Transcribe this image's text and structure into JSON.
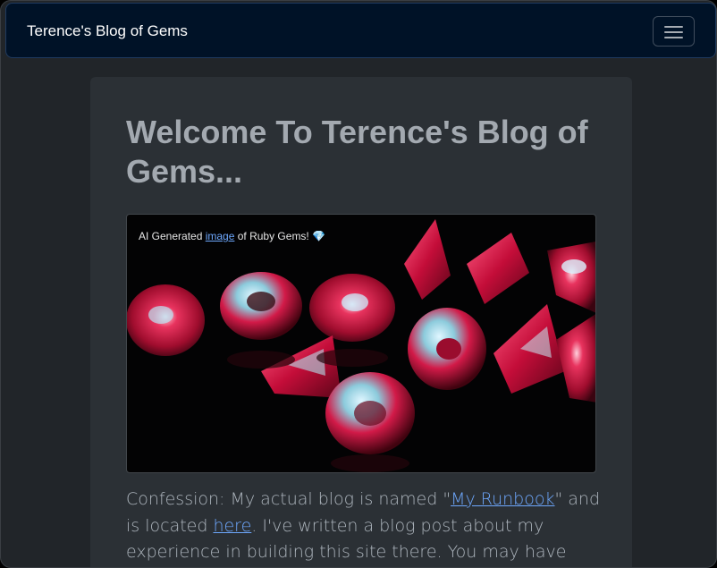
{
  "navbar": {
    "brand": "Terence's Blog of Gems",
    "toggler_icon": "hamburger-menu-icon"
  },
  "main": {
    "heading": "Welcome To Terence's Blog of Gems...",
    "hero": {
      "caption_prefix": "AI Generated ",
      "caption_link": "image",
      "caption_suffix": " of Ruby Gems! ",
      "caption_emoji": "💎"
    },
    "intro": {
      "text1": "Confession: My actual blog is named \"",
      "link1": "My Runbook",
      "text2": "\" and is located ",
      "link2": "here",
      "text3": ". I've written a blog post about my experience in building this site there. You may have found this site from there."
    }
  },
  "colors": {
    "page_bg": "#212529",
    "navbar_bg": "#001227",
    "card_bg": "#2b3035",
    "heading": "#a3a9b0",
    "link": "#6ea8fe",
    "ruby": "#d1123f"
  }
}
